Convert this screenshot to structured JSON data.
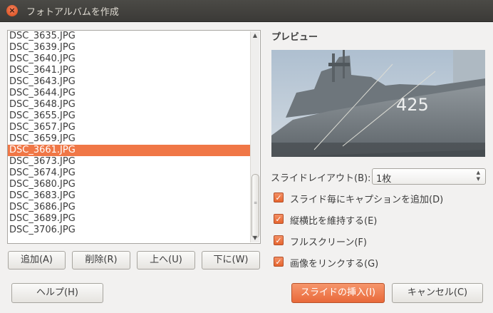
{
  "window": {
    "title": "フォトアルバムを作成",
    "close_icon": "×"
  },
  "files": [
    "DSC_3635.JPG",
    "DSC_3639.JPG",
    "DSC_3640.JPG",
    "DSC_3641.JPG",
    "DSC_3643.JPG",
    "DSC_3644.JPG",
    "DSC_3648.JPG",
    "DSC_3655.JPG",
    "DSC_3657.JPG",
    "DSC_3659.JPG",
    "DSC_3661.JPG",
    "DSC_3673.JPG",
    "DSC_3674.JPG",
    "DSC_3680.JPG",
    "DSC_3683.JPG",
    "DSC_3686.JPG",
    "DSC_3689.JPG",
    "DSC_3706.JPG"
  ],
  "selected_file": "DSC_3661.JPG",
  "list_buttons": {
    "add": "追加(A)",
    "delete": "削除(R)",
    "up": "上へ(U)",
    "down": "下に(W)"
  },
  "preview": {
    "label": "プレビュー",
    "hull_number": "425"
  },
  "layout": {
    "label": "スライドレイアウト(B):",
    "value": "1枚"
  },
  "options": [
    {
      "label": "スライド毎にキャプションを追加(D)",
      "checked": true
    },
    {
      "label": "縦横比を維持する(E)",
      "checked": true
    },
    {
      "label": "フルスクリーン(F)",
      "checked": true
    },
    {
      "label": "画像をリンクする(G)",
      "checked": true
    }
  ],
  "footer": {
    "help": "ヘルプ(H)",
    "insert": "スライドの挿入(I)",
    "cancel": "キャンセル(C)"
  },
  "colors": {
    "accent": "#f07746",
    "titlebar": "#3c3b37"
  }
}
